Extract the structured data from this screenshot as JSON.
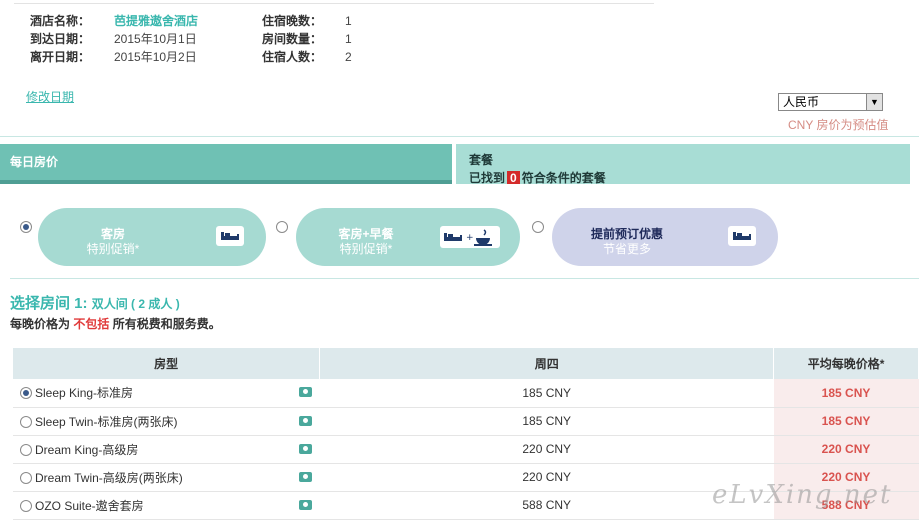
{
  "info": {
    "hotel_label": "酒店名称：",
    "hotel_value": "芭提雅遨舍酒店",
    "arrive_label": "到达日期：",
    "arrive_value": "2015年10月1日",
    "depart_label": "离开日期：",
    "depart_value": "2015年10月2日",
    "nights_label": "住宿晚数：",
    "nights_value": "1",
    "rooms_label": "房间数量：",
    "rooms_value": "1",
    "guests_label": "住宿人数：",
    "guests_value": "2"
  },
  "modify_link": "修改日期",
  "currency": {
    "selected": "人民币",
    "note": "CNY 房价为预估值"
  },
  "tabs": {
    "daily": "每日房价",
    "package_title": "套餐",
    "package_found_prefix": "已找到",
    "package_count": "0",
    "package_found_suffix": "符合条件的套餐"
  },
  "offers": [
    {
      "title": "客房",
      "subtitle": "特别促销*"
    },
    {
      "title": "客房+早餐",
      "subtitle": "特别促销*"
    },
    {
      "title": "提前预订优惠",
      "subtitle": "节省更多"
    }
  ],
  "section": {
    "title": "选择房间 1:",
    "subtitle": "双人间 ( 2 成人 )",
    "note_prefix": "每晚价格为",
    "note_highlight": "不包括",
    "note_suffix": "所有税费和服务费。"
  },
  "table": {
    "headers": [
      "房型",
      "周四",
      "平均每晚价格*"
    ],
    "rows": [
      {
        "name": "Sleep King-标准房",
        "day": "185 CNY",
        "avg": "185 CNY"
      },
      {
        "name": "Sleep Twin-标准房(两张床)",
        "day": "185 CNY",
        "avg": "185 CNY"
      },
      {
        "name": "Dream King-高级房",
        "day": "220 CNY",
        "avg": "220 CNY"
      },
      {
        "name": "Dream Twin-高级房(两张床)",
        "day": "220 CNY",
        "avg": "220 CNY"
      },
      {
        "name": "OZO Suite-遨舍套房",
        "day": "588 CNY",
        "avg": "588 CNY"
      }
    ]
  },
  "watermark": "eLvXing.net",
  "colors": {
    "accent": "#3ab7ae",
    "tab_active": "#6fc1b4",
    "tab_inactive": "#a8ddd5",
    "price_red": "#d9534f"
  }
}
